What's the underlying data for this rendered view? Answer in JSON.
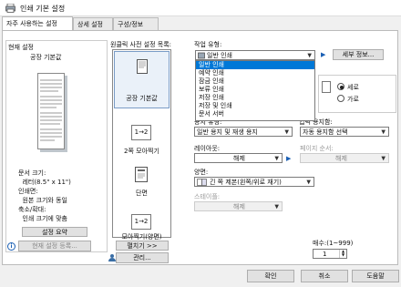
{
  "window": {
    "title": "인쇄 기본 설정"
  },
  "tabs": [
    {
      "label": "자주 사용하는 설정"
    },
    {
      "label": "상세 설정"
    },
    {
      "label": "구성/정보"
    }
  ],
  "current_settings": {
    "group_label": "현재 설정",
    "preset_name": "공장 기본값",
    "summary_lines": [
      "문서 크기:",
      "  레터(8.5\" x 11\")",
      "인쇄면:",
      "  원본 크기와 동일",
      "축소/확대:",
      "  인쇄 크기에 맞춤"
    ],
    "summary_button": "설정 요약",
    "save_button": "현재 설정 등록..."
  },
  "presets": {
    "group_label": "원클릭 사전 설정 목록:",
    "items": [
      {
        "label": "공장 기본값",
        "icon": "document-icon"
      },
      {
        "label": "2쪽 모아찍기",
        "icon": "two-up-icon",
        "glyph": "1→2"
      },
      {
        "label": "단면",
        "icon": "single-sided-icon"
      },
      {
        "label": "모아찍기(양면)",
        "icon": "combine-duplex-icon",
        "glyph": "1→2"
      }
    ],
    "more_button": "펼치기 >>",
    "manage_button": "관리..."
  },
  "job_type": {
    "label": "작업 유형:",
    "value": "일반 인쇄",
    "details_button": "세부 정보...",
    "options": [
      "일반 인쇄",
      "예약 인쇄",
      "잠금 인쇄",
      "보류 인쇄",
      "저장 인쇄",
      "저장 및 인쇄",
      "문서 서버"
    ],
    "selected_index": 0
  },
  "orientation": {
    "portrait": "세로",
    "landscape": "가로",
    "selected": "portrait"
  },
  "paper_type": {
    "label": "용지 유형:",
    "value": "일반 용지 및 재생 용지"
  },
  "paper_tray": {
    "label": "입력 용지함:",
    "value": "자동 용지함 선택"
  },
  "layout": {
    "label": "레이아웃:",
    "value": "해제"
  },
  "page_order": {
    "label": "페이지 순서:",
    "value": "해제"
  },
  "duplex": {
    "label": "양면:",
    "value": "긴 쪽 제본(왼쪽/위로 재기)"
  },
  "staple": {
    "label": "스테이플:",
    "value": "해제"
  },
  "copies": {
    "label": "매수:(1~999)",
    "value": "1"
  },
  "footer": {
    "ok": "확인",
    "cancel": "취소",
    "help": "도움말"
  }
}
